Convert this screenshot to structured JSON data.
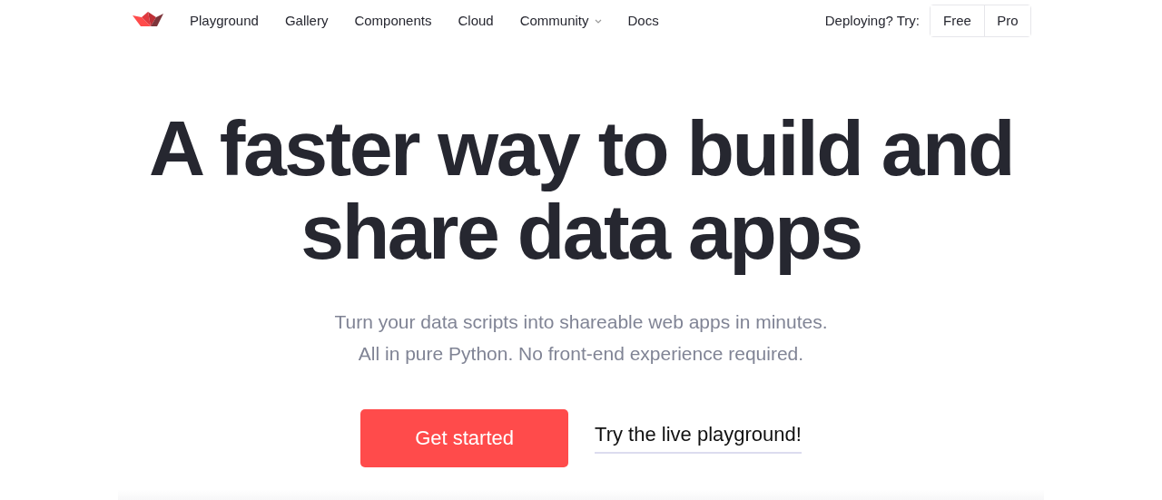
{
  "nav": {
    "items": [
      {
        "label": "Playground",
        "kind": "link"
      },
      {
        "label": "Gallery",
        "kind": "link"
      },
      {
        "label": "Components",
        "kind": "link"
      },
      {
        "label": "Cloud",
        "kind": "link"
      },
      {
        "label": "Community",
        "kind": "dropdown"
      },
      {
        "label": "Docs",
        "kind": "link"
      }
    ],
    "deploy_label": "Deploying? Try:",
    "deploy_buttons": [
      "Free",
      "Pro"
    ]
  },
  "hero": {
    "headline": [
      "A faster way to build and",
      "share data apps"
    ],
    "subtitle": [
      "Turn your data scripts into shareable web apps in minutes.",
      "All in pure Python. No front-end experience required."
    ],
    "primary_button": "Get started",
    "secondary_link": "Try the live playground!"
  }
}
